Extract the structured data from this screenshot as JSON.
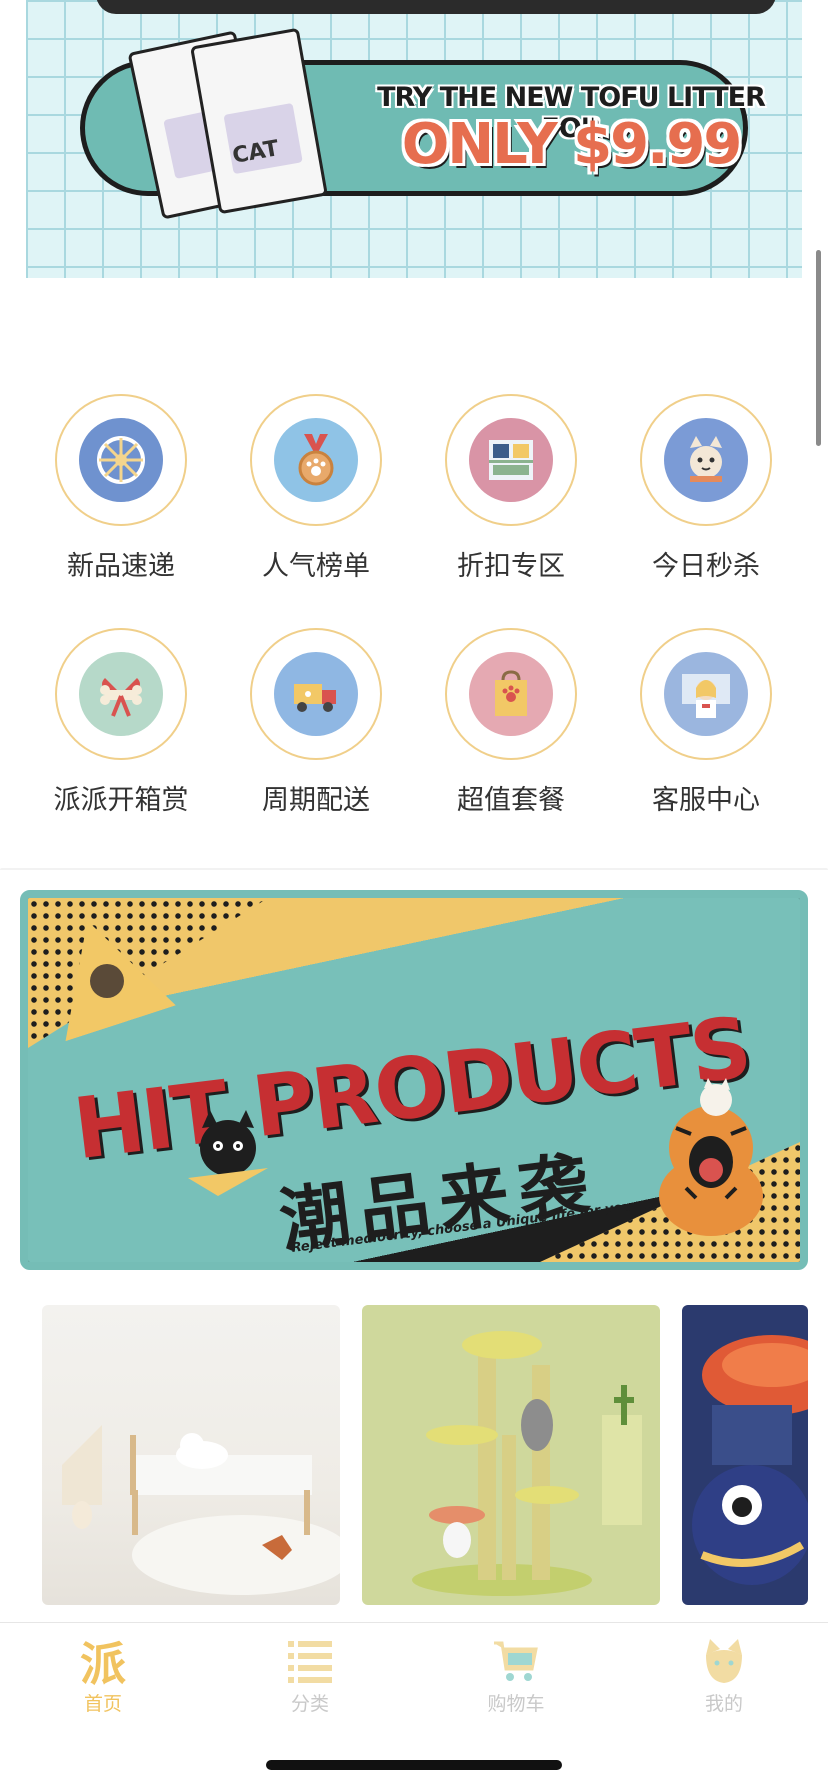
{
  "promo_banner": {
    "line1": "TRY THE NEW TOFU LITTER FOR",
    "line2": "ONLY $9.99",
    "bag_text": "CAT"
  },
  "categories": [
    {
      "label": "新品速递",
      "icon": "ferris-wheel-icon",
      "color": "#6f92cf"
    },
    {
      "label": "人气榜单",
      "icon": "medal-icon",
      "color": "#8fc3e6"
    },
    {
      "label": "折扣专区",
      "icon": "pet-food-shelf-icon",
      "color": "#d994a6"
    },
    {
      "label": "今日秒杀",
      "icon": "cat-face-icon",
      "color": "#7b9bd6"
    },
    {
      "label": "派派开箱赏",
      "icon": "gift-bone-icon",
      "color": "#b6d9c9"
    },
    {
      "label": "周期配送",
      "icon": "delivery-truck-icon",
      "color": "#8fb7e3"
    },
    {
      "label": "超值套餐",
      "icon": "shopping-bag-icon",
      "color": "#e5a9b2"
    },
    {
      "label": "客服中心",
      "icon": "service-girl-icon",
      "color": "#9bb6df"
    }
  ],
  "hit_banner": {
    "title": "HIT PRODUCTS",
    "title_cn": "潮品来袭",
    "tagline": "Reject mediocrity, choose a Unique life for your pets"
  },
  "tabbar": {
    "items": [
      {
        "label": "首页",
        "icon": "home-pai-icon",
        "active": true
      },
      {
        "label": "分类",
        "icon": "list-icon",
        "active": false
      },
      {
        "label": "购物车",
        "icon": "cart-icon",
        "active": false
      },
      {
        "label": "我的",
        "icon": "cat-head-icon",
        "active": false
      }
    ],
    "home_glyph": "派"
  },
  "colors": {
    "accent": "#f1c35f",
    "ring": "#f0cf8a",
    "teal": "#75bdb6",
    "tab_inactive": "#c9c9c9"
  }
}
